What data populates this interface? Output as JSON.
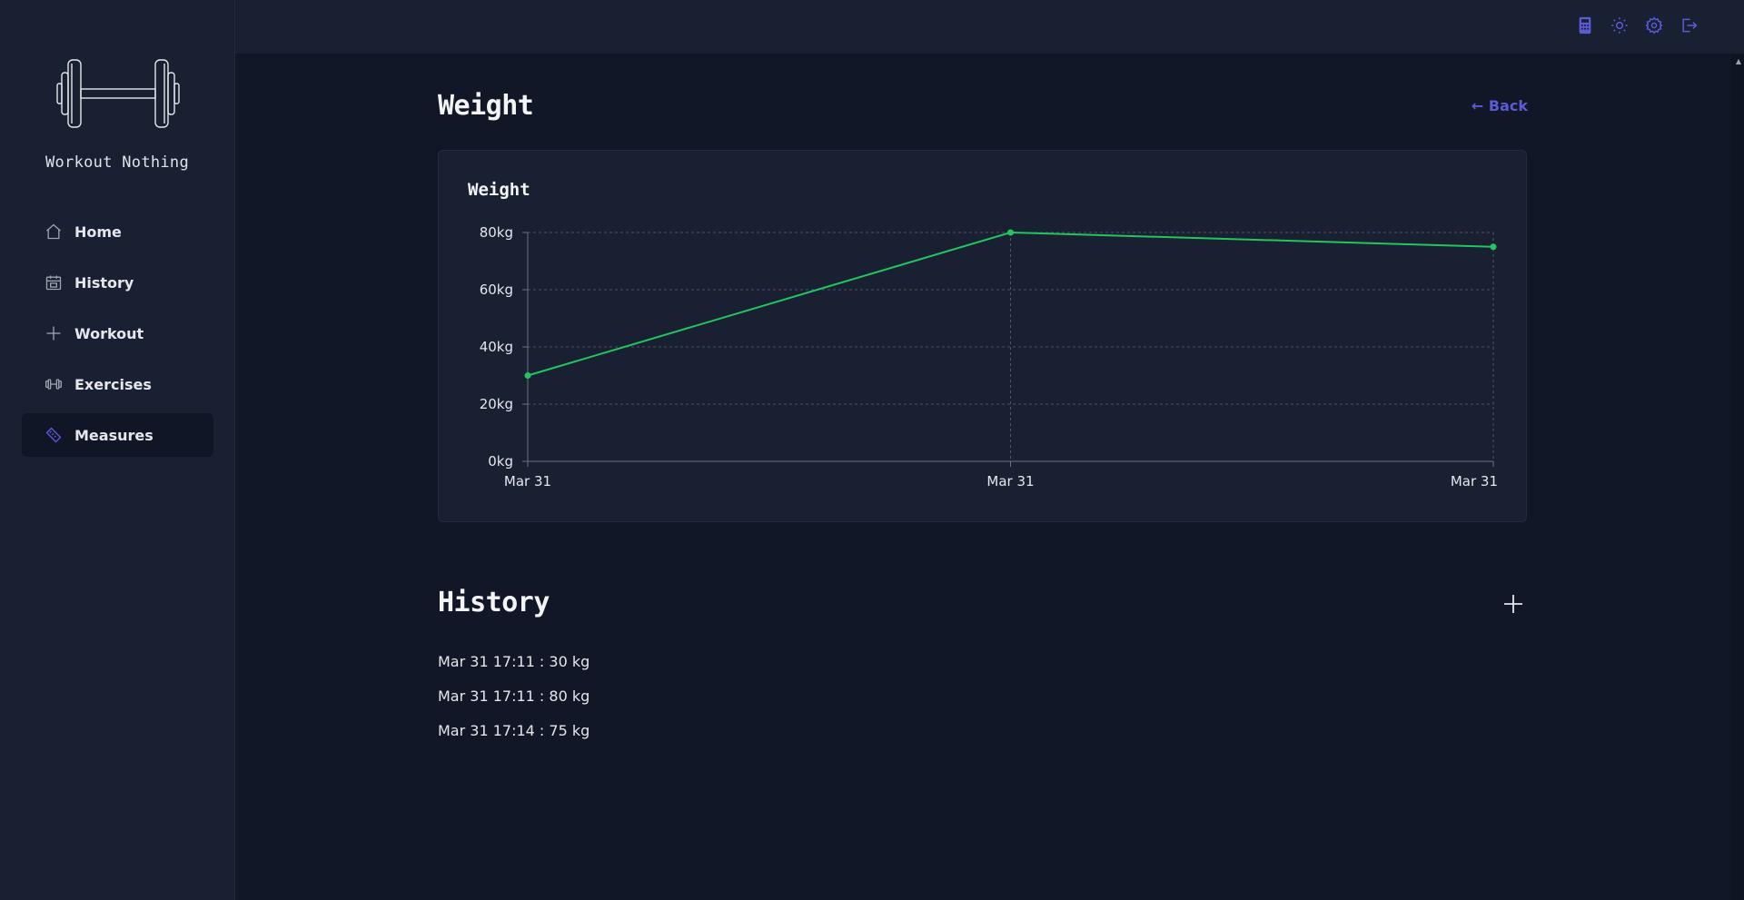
{
  "app": {
    "name": "Workout Nothing"
  },
  "sidebar": {
    "items": [
      {
        "label": "Home",
        "icon": "home-icon",
        "active": false
      },
      {
        "label": "History",
        "icon": "calendar-icon",
        "active": false
      },
      {
        "label": "Workout",
        "icon": "plus-icon",
        "active": false
      },
      {
        "label": "Exercises",
        "icon": "dumbbell-icon",
        "active": false
      },
      {
        "label": "Measures",
        "icon": "ruler-icon",
        "active": true
      }
    ]
  },
  "topbar": {
    "icons": [
      "calculator-icon",
      "sun-icon",
      "gear-icon",
      "logout-icon"
    ]
  },
  "page": {
    "title": "Weight",
    "back_label": "← Back"
  },
  "chart_data": {
    "type": "line",
    "title": "Weight",
    "x": [
      "Mar 31",
      "Mar 31",
      "Mar 31"
    ],
    "series": [
      {
        "values": [
          30,
          80,
          75
        ],
        "color": "#22c55e"
      }
    ],
    "yticks": [
      "0kg",
      "20kg",
      "40kg",
      "60kg",
      "80kg"
    ],
    "ylim": [
      0,
      80
    ],
    "grid": true
  },
  "history": {
    "title": "History",
    "entries": [
      {
        "date": "Mar 31 17:11 :",
        "value": "30 kg"
      },
      {
        "date": "Mar 31 17:11 :",
        "value": "80 kg"
      },
      {
        "date": "Mar 31 17:14 :",
        "value": "75 kg"
      }
    ]
  },
  "colors": {
    "accent": "#5b5bd6",
    "line": "#22c55e",
    "background": "#111727",
    "panel": "#182032"
  }
}
